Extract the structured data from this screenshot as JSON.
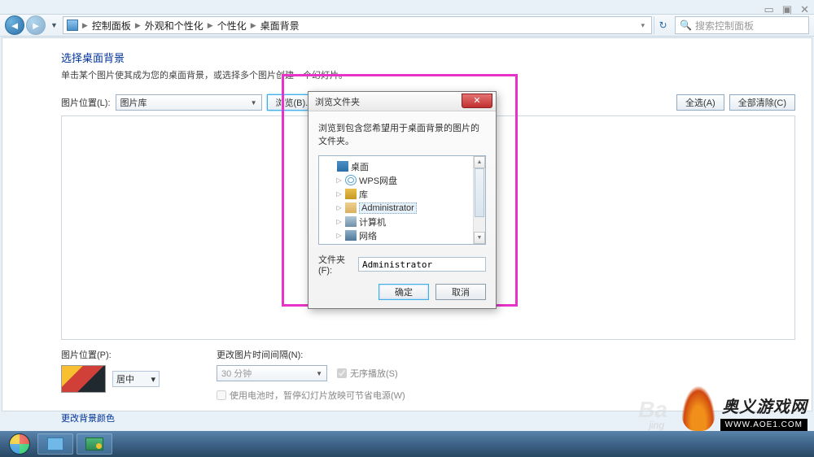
{
  "window": {
    "min": "▭",
    "max": "▣",
    "close": "✕"
  },
  "nav": {
    "crumbs": [
      "控制面板",
      "外观和个性化",
      "个性化",
      "桌面背景"
    ],
    "search_placeholder": "搜索控制面板"
  },
  "page": {
    "title": "选择桌面背景",
    "subtitle": "单击某个图片使其成为您的桌面背景，或选择多个图片创建一个幻灯片。",
    "loc_label": "图片位置(L):",
    "loc_value": "图片库",
    "browse_btn": "浏览(B)...",
    "select_all": "全选(A)",
    "clear_all": "全部清除(C)",
    "pos_label": "图片位置(P):",
    "fit_value": "居中",
    "interval_label": "更改图片时间间隔(N):",
    "interval_value": "30 分钟",
    "shuffle": "无序播放(S)",
    "battery": "使用电池时，暂停幻灯片放映可节省电源(W)",
    "change_color": "更改背景颜色"
  },
  "dialog": {
    "title": "浏览文件夹",
    "message": "浏览到包含您希望用于桌面背景的图片的文件夹。",
    "items": {
      "desktop": "桌面",
      "wps": "WPS网盘",
      "library": "库",
      "admin": "Administrator",
      "computer": "计算机",
      "network": "网络"
    },
    "folder_label": "文件夹(F):",
    "folder_value": "Administrator",
    "ok": "确定",
    "cancel": "取消"
  },
  "watermark": {
    "bai": "Ba",
    "jing": "jing",
    "main": "奥义游戏网",
    "sub": "WWW.AOE1.COM"
  }
}
